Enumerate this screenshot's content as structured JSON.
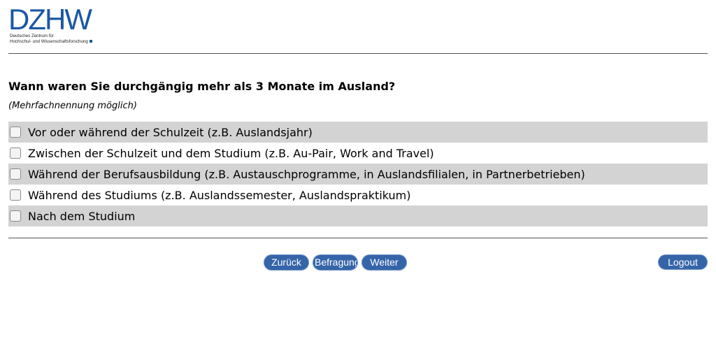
{
  "logo": {
    "wordmark": "DZHW",
    "subtitle_line1": "Deutsches Zentrum für",
    "subtitle_line2": "Hochschul- und Wissenschaftsforschung",
    "color": "#1b57a5"
  },
  "question": {
    "title": "Wann waren Sie durchgängig mehr als 3 Monate im Ausland?",
    "hint": "(Mehrfachnennung möglich)"
  },
  "options": [
    {
      "label": "Vor oder während der Schulzeit (z.B. Auslandsjahr)",
      "checked": false
    },
    {
      "label": "Zwischen der Schulzeit und dem Studium (z.B. Au-Pair, Work and Travel)",
      "checked": false
    },
    {
      "label": "Während der Berufsausbildung (z.B. Austauschprogramme, in Auslandsfilialen, in Partnerbetrieben)",
      "checked": false
    },
    {
      "label": "Während des Studiums (z.B. Auslandssemester, Auslandspraktikum)",
      "checked": false
    },
    {
      "label": "Nach dem Studium",
      "checked": false
    }
  ],
  "nav": {
    "back_label": "Zurück",
    "survey_label": "Befragung",
    "next_label": "Weiter",
    "logout_label": "Logout"
  },
  "colors": {
    "button_bg": "#3565a8",
    "row_shade": "#d3d3d3"
  }
}
